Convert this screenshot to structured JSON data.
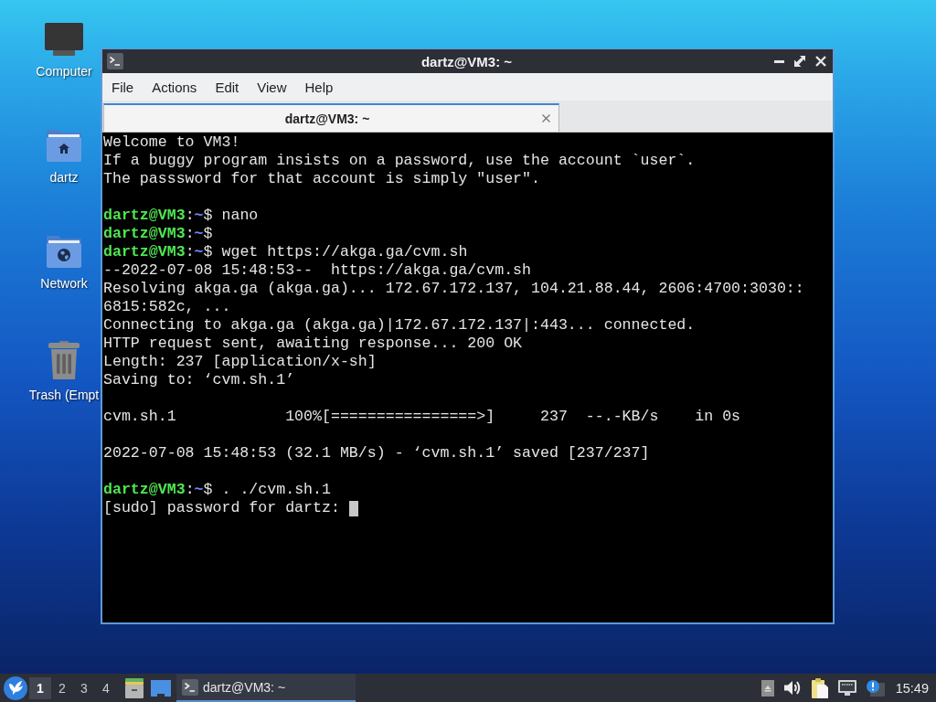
{
  "desktop_icons": [
    {
      "kind": "computer",
      "label": "Computer"
    },
    {
      "kind": "home",
      "label": "dartz"
    },
    {
      "kind": "network",
      "label": "Network"
    },
    {
      "kind": "trash",
      "label": "Trash (Empt"
    }
  ],
  "window": {
    "title": "dartz@VM3: ~",
    "menu": [
      "File",
      "Actions",
      "Edit",
      "View",
      "Help"
    ],
    "tabs": [
      {
        "label": "dartz@VM3: ~",
        "selected": true
      }
    ]
  },
  "terminal": {
    "blocks": [
      {
        "lines": [
          {
            "kind": "output",
            "text": "Welcome to VM3!"
          },
          {
            "kind": "output",
            "text": "If a buggy program insists on a password, use the account `user`."
          },
          {
            "kind": "output",
            "text": "The passsword for that account is simply \"user\"."
          }
        ]
      },
      {
        "lines": [
          {
            "kind": "prompt",
            "user": "dartz@VM3",
            "colon": ":",
            "path": "~",
            "sign": "$",
            "command": "nano"
          },
          {
            "kind": "prompt",
            "user": "dartz@VM3",
            "colon": ":",
            "path": "~",
            "sign": "$"
          },
          {
            "kind": "prompt",
            "user": "dartz@VM3",
            "colon": ":",
            "path": "~",
            "sign": "$",
            "command": "wget https://akga.ga/cvm.sh"
          },
          {
            "kind": "output",
            "text": "--2022-07-08 15:48:53--  https://akga.ga/cvm.sh"
          },
          {
            "kind": "output",
            "text": "Resolving akga.ga (akga.ga)... 172.67.172.137, 104.21.88.44, 2606:4700:3030::"
          },
          {
            "kind": "output",
            "text": "6815:582c, ..."
          },
          {
            "kind": "output",
            "text": "Connecting to akga.ga (akga.ga)|172.67.172.137|:443... connected."
          },
          {
            "kind": "output",
            "text": "HTTP request sent, awaiting response... 200 OK"
          },
          {
            "kind": "output",
            "text": "Length: 237 [application/x-sh]"
          },
          {
            "kind": "output",
            "text": "Saving to: ‘cvm.sh.1’"
          }
        ]
      },
      {
        "lines": [
          {
            "kind": "output",
            "text": "cvm.sh.1            100%[================>]     237  --.-KB/s    in 0s"
          }
        ]
      },
      {
        "lines": [
          {
            "kind": "output",
            "text": "2022-07-08 15:48:53 (32.1 MB/s) - ‘cvm.sh.1’ saved [237/237]"
          }
        ]
      },
      {
        "lines": [
          {
            "kind": "prompt",
            "user": "dartz@VM3",
            "colon": ":",
            "path": "~",
            "sign": "$",
            "command": ". ./cvm.sh.1"
          },
          {
            "kind": "output",
            "text": "[sudo] password for dartz:"
          }
        ]
      }
    ],
    "cursor": true
  },
  "taskbar": {
    "workspaces": [
      {
        "label": "1",
        "selected": true
      },
      {
        "label": "2",
        "selected": false
      },
      {
        "label": "3",
        "selected": false
      },
      {
        "label": "4",
        "selected": false
      }
    ],
    "tasks": [
      {
        "label": "dartz@VM3: ~",
        "selected": true
      }
    ],
    "clock": "15:49"
  }
}
